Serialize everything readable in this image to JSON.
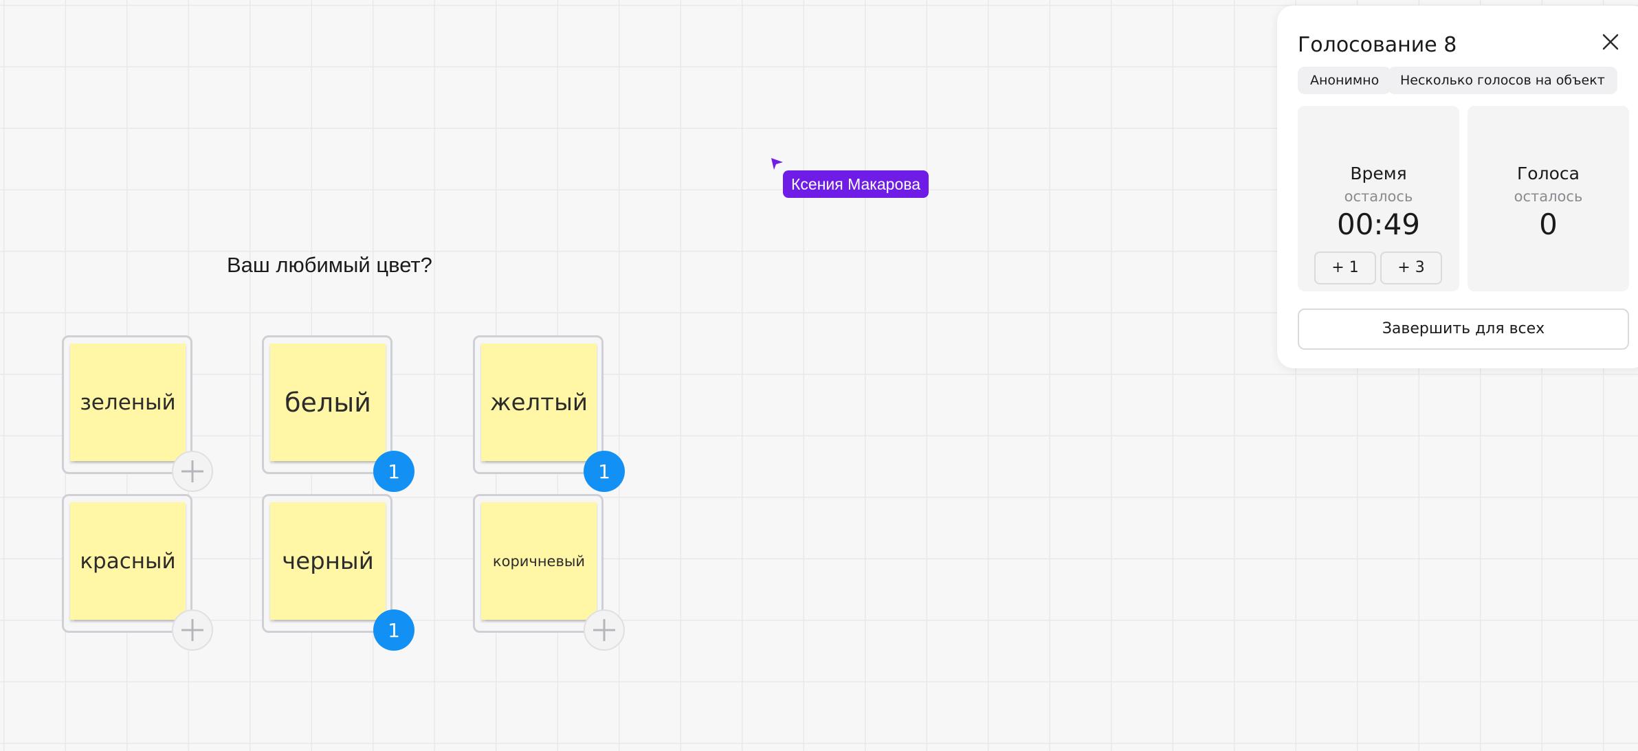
{
  "board": {
    "question": "Ваш любимый цвет?",
    "collaborator_cursor": {
      "name": "Ксения Макарова",
      "color": "#6f1de6"
    },
    "stickies": [
      {
        "text": "зеленый",
        "votes": null
      },
      {
        "text": "белый",
        "votes": "1"
      },
      {
        "text": "желтый",
        "votes": "1"
      },
      {
        "text": "красный",
        "votes": null
      },
      {
        "text": "черный",
        "votes": "1"
      },
      {
        "text": "коричневый",
        "votes": null
      }
    ]
  },
  "voting_panel": {
    "title": "Голосование 8",
    "close_icon": "close-icon",
    "tags": [
      "Анонимно",
      "Несколько голосов на объект"
    ],
    "time": {
      "label": "Время",
      "sublabel": "осталось",
      "value": "00:49",
      "add_buttons": [
        "+ 1",
        "+ 3"
      ]
    },
    "votes": {
      "label": "Голоса",
      "sublabel": "осталось",
      "value": "0"
    },
    "finish_button": "Завершить для всех"
  },
  "colors": {
    "vote_badge": "#1390f4",
    "sticky": "#fff6a6",
    "accent": "#6f1de6"
  }
}
